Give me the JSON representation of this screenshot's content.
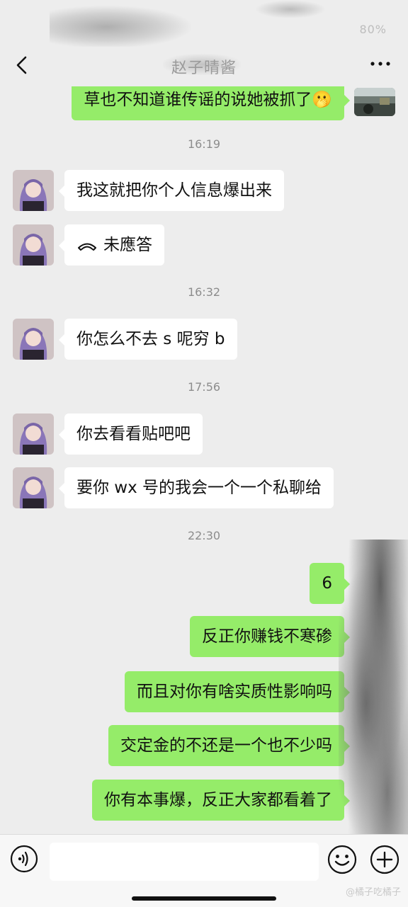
{
  "status_bar": {
    "right_text": "80%"
  },
  "nav": {
    "title": "赵子晴酱"
  },
  "messages": [
    {
      "type": "out",
      "text": "草也不知道谁传谣的说她被抓了🫢"
    },
    {
      "type": "time",
      "text": "16:19"
    },
    {
      "type": "in",
      "text": "我这就把你个人信息爆出来"
    },
    {
      "type": "in",
      "text": "未應答",
      "icon": "phone-declined-icon"
    },
    {
      "type": "time",
      "text": "16:32"
    },
    {
      "type": "in",
      "text": "你怎么不去 s 呢穷 b"
    },
    {
      "type": "time",
      "text": "17:56"
    },
    {
      "type": "in",
      "text": "你去看看贴吧吧"
    },
    {
      "type": "in",
      "text": "要你 wx 号的我会一个一个私聊给"
    },
    {
      "type": "time",
      "text": "22:30"
    },
    {
      "type": "out",
      "text": "6"
    },
    {
      "type": "out",
      "text": "反正你赚钱不寒碜"
    },
    {
      "type": "out",
      "text": "而且对你有啥实质性影响吗"
    },
    {
      "type": "out",
      "text": "交定金的不还是一个也不少吗"
    },
    {
      "type": "out",
      "text": "你有本事爆，反正大家都看着了"
    }
  ],
  "input": {
    "value": ""
  },
  "watermark": "@橘子吃橘子",
  "colors": {
    "outgoing": "#95ec69",
    "incoming": "#ffffff",
    "background": "#ededed"
  }
}
